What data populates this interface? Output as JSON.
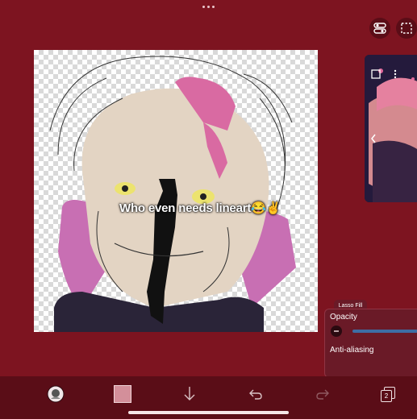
{
  "canvas": {
    "caption": "Who even needs lineart😂✌️"
  },
  "lasso_fill": {
    "tab_label": "Lasso Fill",
    "opacity_label": "Opacity",
    "opacity_value": 1.0,
    "anti_aliasing_label": "Anti-aliasing"
  },
  "toolbar": {
    "layers_count": "2",
    "color_swatch": "#d38f9a"
  },
  "colors": {
    "background": "#7d1420",
    "toolbar": "#5a0d17",
    "accent": "#3d6ea5"
  },
  "icons": [
    "profile-icon",
    "color-swatch",
    "download-icon",
    "undo-icon",
    "redo-icon",
    "layers-icon",
    "toggle-icon",
    "selection-icon",
    "checkbox-icon",
    "more-icon",
    "chevron-left-icon"
  ]
}
